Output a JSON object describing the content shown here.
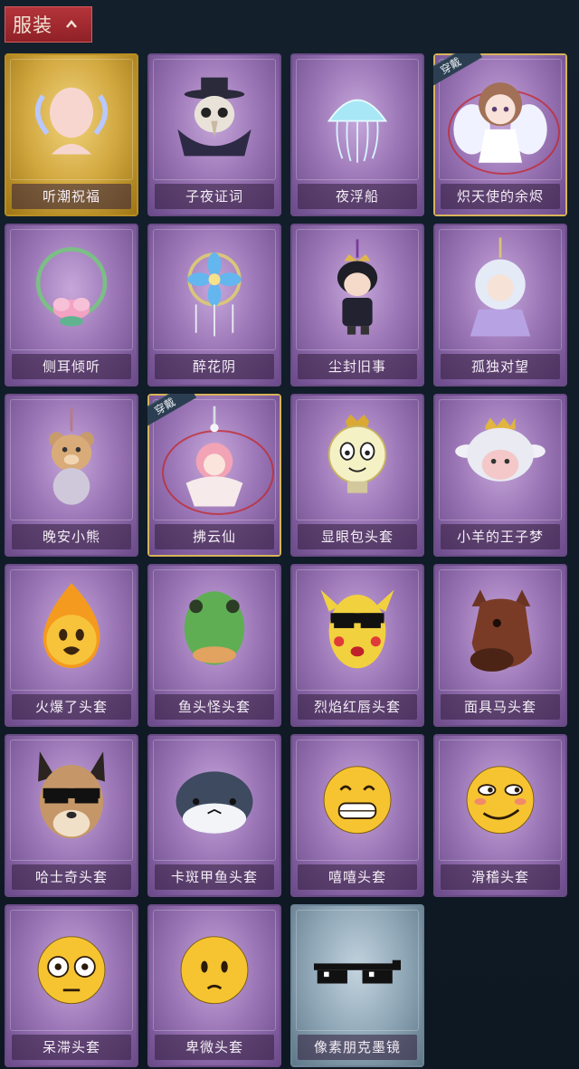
{
  "header": {
    "tab_label": "服装"
  },
  "worn_label": "穿戴",
  "items": [
    {
      "name": "听潮祝福",
      "rarity": "gold",
      "icon": "angel-head-icon",
      "worn": false
    },
    {
      "name": "子夜证词",
      "rarity": "purple",
      "icon": "plague-doctor-icon",
      "worn": false
    },
    {
      "name": "夜浮船",
      "rarity": "purple",
      "icon": "jellyfish-icon",
      "worn": false
    },
    {
      "name": "炽天使的余烬",
      "rarity": "purple",
      "icon": "angel-doll-icon",
      "worn": true
    },
    {
      "name": "侧耳倾听",
      "rarity": "purple",
      "icon": "lotus-wreath-icon",
      "worn": false
    },
    {
      "name": "醉花阴",
      "rarity": "purple",
      "icon": "flower-ornament-icon",
      "worn": false
    },
    {
      "name": "尘封旧事",
      "rarity": "purple",
      "icon": "boy-doll-icon",
      "worn": false
    },
    {
      "name": "孤独对望",
      "rarity": "purple",
      "icon": "white-hair-doll-icon",
      "worn": false
    },
    {
      "name": "晚安小熊",
      "rarity": "purple",
      "icon": "teddy-bear-icon",
      "worn": false
    },
    {
      "name": "拂云仙",
      "rarity": "purple",
      "icon": "fairy-doll-icon",
      "worn": true
    },
    {
      "name": "显眼包头套",
      "rarity": "purple",
      "icon": "bulb-head-icon",
      "worn": false
    },
    {
      "name": "小羊的王子梦",
      "rarity": "purple",
      "icon": "sheep-crown-icon",
      "worn": false
    },
    {
      "name": "火爆了头套",
      "rarity": "purple",
      "icon": "fire-head-icon",
      "worn": false
    },
    {
      "name": "鱼头怪头套",
      "rarity": "purple",
      "icon": "fish-head-icon",
      "worn": false
    },
    {
      "name": "烈焰红唇头套",
      "rarity": "purple",
      "icon": "pikachu-mask-icon",
      "worn": false
    },
    {
      "name": "面具马头套",
      "rarity": "purple",
      "icon": "horse-mask-icon",
      "worn": false
    },
    {
      "name": "哈士奇头套",
      "rarity": "purple",
      "icon": "husky-mask-icon",
      "worn": false
    },
    {
      "name": "卡斑甲鱼头套",
      "rarity": "purple",
      "icon": "whale-head-icon",
      "worn": false
    },
    {
      "name": "嘻嘻头套",
      "rarity": "purple",
      "icon": "grin-emoji-icon",
      "worn": false
    },
    {
      "name": "滑稽头套",
      "rarity": "purple",
      "icon": "smirk-emoji-icon",
      "worn": false
    },
    {
      "name": "呆滞头套",
      "rarity": "purple",
      "icon": "blank-emoji-icon",
      "worn": false
    },
    {
      "name": "卑微头套",
      "rarity": "purple",
      "icon": "shy-emoji-icon",
      "worn": false
    },
    {
      "name": "像素朋克墨镜",
      "rarity": "blue",
      "icon": "pixel-sunglasses-icon",
      "worn": false
    }
  ]
}
